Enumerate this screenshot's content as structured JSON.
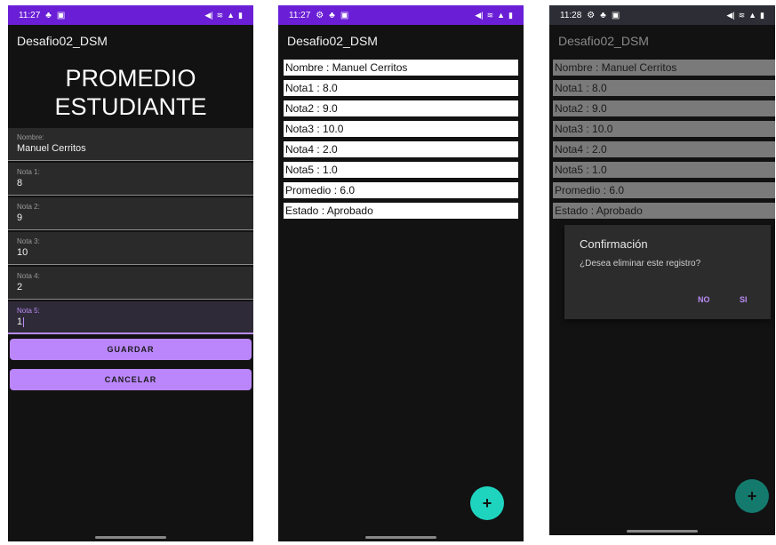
{
  "screen1": {
    "status_time": "11:27",
    "app_title": "Desafio02_DSM",
    "heading_line1": "PROMEDIO",
    "heading_line2": "ESTUDIANTE",
    "fields": [
      {
        "label": "Nombre:",
        "value": "Manuel Cerritos"
      },
      {
        "label": "Nota 1:",
        "value": "8"
      },
      {
        "label": "Nota 2:",
        "value": "9"
      },
      {
        "label": "Nota 3:",
        "value": "10"
      },
      {
        "label": "Nota 4:",
        "value": "2"
      },
      {
        "label": "Nota 5:",
        "value": "1"
      }
    ],
    "save_label": "GUARDAR",
    "cancel_label": "CANCELAR"
  },
  "screen2": {
    "status_time": "11:27",
    "app_title": "Desafio02_DSM",
    "items": [
      "Nombre : Manuel Cerritos",
      "Nota1 : 8.0",
      "Nota2 : 9.0",
      "Nota3 : 10.0",
      "Nota4 : 2.0",
      "Nota5 : 1.0",
      "Promedio : 6.0",
      "Estado : Aprobado"
    ],
    "fab_label": "+"
  },
  "screen3": {
    "status_time": "11:28",
    "app_title": "Desafio02_DSM",
    "items": [
      "Nombre : Manuel Cerritos",
      "Nota1 : 8.0",
      "Nota2 : 9.0",
      "Nota3 : 10.0",
      "Nota4 : 2.0",
      "Nota5 : 1.0",
      "Promedio : 6.0",
      "Estado : Aprobado"
    ],
    "dialog": {
      "title": "Confirmación",
      "message": "¿Desea eliminar este registro?",
      "no_label": "NO",
      "yes_label": "SI"
    },
    "fab_label": "+"
  },
  "colors": {
    "status_bar": "#6a1fd6",
    "accent": "#bb86fc",
    "fab": "#1fd4bf"
  }
}
